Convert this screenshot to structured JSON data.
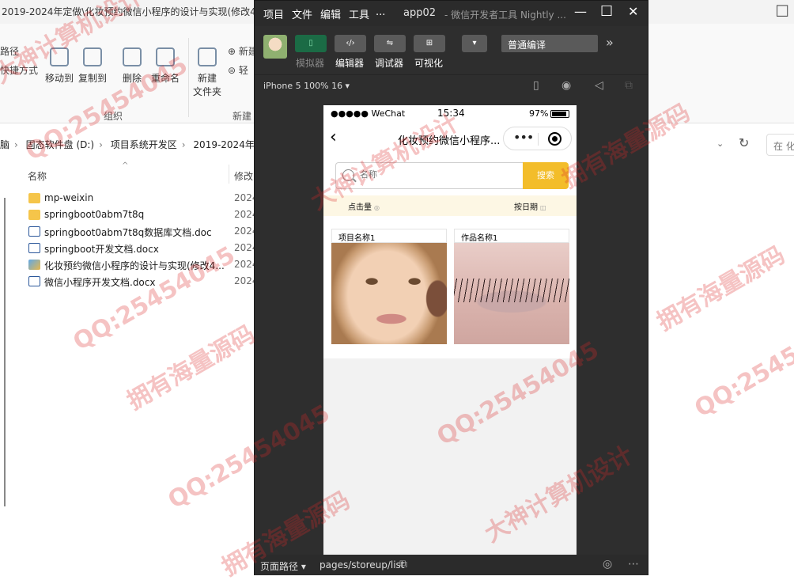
{
  "explorer": {
    "title": "2019-2024年定做\\化妆预约微信小程序的设计与实现(修改4",
    "ribbon": {
      "left_items": [
        "路径",
        "快捷方式"
      ],
      "move_to": "移动到",
      "copy_to": "复制到",
      "delete": "删除",
      "rename": "重命名",
      "new_folder": "新建\n文件夹",
      "new_item_a": "新建",
      "new_item_b": "轻",
      "group_organize": "组织",
      "group_new": "新建"
    },
    "breadcrumbs": [
      "脑",
      "固态软件盘 (D:)",
      "项目系统开发区",
      "2019-2024年"
    ],
    "search_placeholder": "在 化",
    "columns": {
      "name": "名称",
      "modified": "修改"
    },
    "files": [
      {
        "name": "mp-weixin",
        "date": "2024",
        "icon": "folder"
      },
      {
        "name": "springboot0abm7t8q",
        "date": "2024",
        "icon": "folder"
      },
      {
        "name": "springboot0abm7t8q数据库文档.doc",
        "date": "2024",
        "icon": "doc"
      },
      {
        "name": "springboot开发文档.docx",
        "date": "2024",
        "icon": "doc"
      },
      {
        "name": "化妆预约微信小程序的设计与实现(修改4...",
        "date": "2024",
        "icon": "img"
      },
      {
        "name": "微信小程序开发文档.docx",
        "date": "2024",
        "icon": "doc"
      }
    ]
  },
  "devtools": {
    "menu": [
      "项目",
      "文件",
      "编辑",
      "工具",
      "..."
    ],
    "app_name": "app02",
    "subtitle": "- 微信开发者工具 Nightly ...",
    "toolbar": {
      "simulator": "模拟器",
      "editor": "编辑器",
      "debugger": "调试器",
      "visual": "可视化",
      "compile_mode": "普通编译"
    },
    "device": "iPhone 5 100% 16 ▾",
    "bottom": {
      "path_label": "页面路径 ▾",
      "path": "pages/storeup/list"
    }
  },
  "phone": {
    "carrier": "●●●●● WeChat",
    "time": "15:34",
    "battery": "97%",
    "nav_title": "化妆预约微信小程序...",
    "search": {
      "placeholder": "名称",
      "button": "搜索"
    },
    "sort": {
      "by_clicks": "点击量",
      "by_date": "按日期"
    },
    "items": [
      {
        "name": "项目名称1",
        "image": "face-makeup-photo"
      },
      {
        "name": "作品名称1",
        "image": "eyelash-photo"
      }
    ]
  },
  "watermarks": [
    "大神计算机设计",
    "QQ:25454045",
    "拥有海量源码",
    "QQ:25454045",
    "大神计算机设计",
    "拥有海量源码",
    "QQ:25454",
    "QQ:25454045",
    "大神计算机设计",
    "拥有海量源码",
    "QQ:25454045",
    "拥有海量源码"
  ],
  "colors": {
    "accent": "#f3bd2a",
    "sim_active": "#1b6b45",
    "watermark": "#dc2828"
  }
}
